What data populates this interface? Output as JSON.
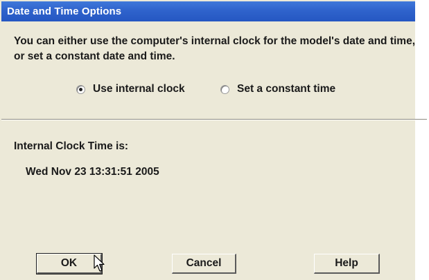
{
  "window": {
    "title": "Date and Time Options"
  },
  "description": "You can either use the computer's internal clock for the model's date and time, or set a constant date and time.",
  "time_source": {
    "options": [
      {
        "label": "Use internal clock",
        "selected": true
      },
      {
        "label": "Set a constant time",
        "selected": false
      }
    ]
  },
  "clock": {
    "label": "Internal Clock Time is:",
    "value": "Wed Nov 23 13:31:51 2005"
  },
  "buttons": {
    "ok": "OK",
    "cancel": "Cancel",
    "help": "Help"
  },
  "colors": {
    "titlebar": "#2f63cc",
    "dialog_background": "#ece9d8"
  },
  "icons": {
    "pointer": "mouse-pointer-icon"
  }
}
